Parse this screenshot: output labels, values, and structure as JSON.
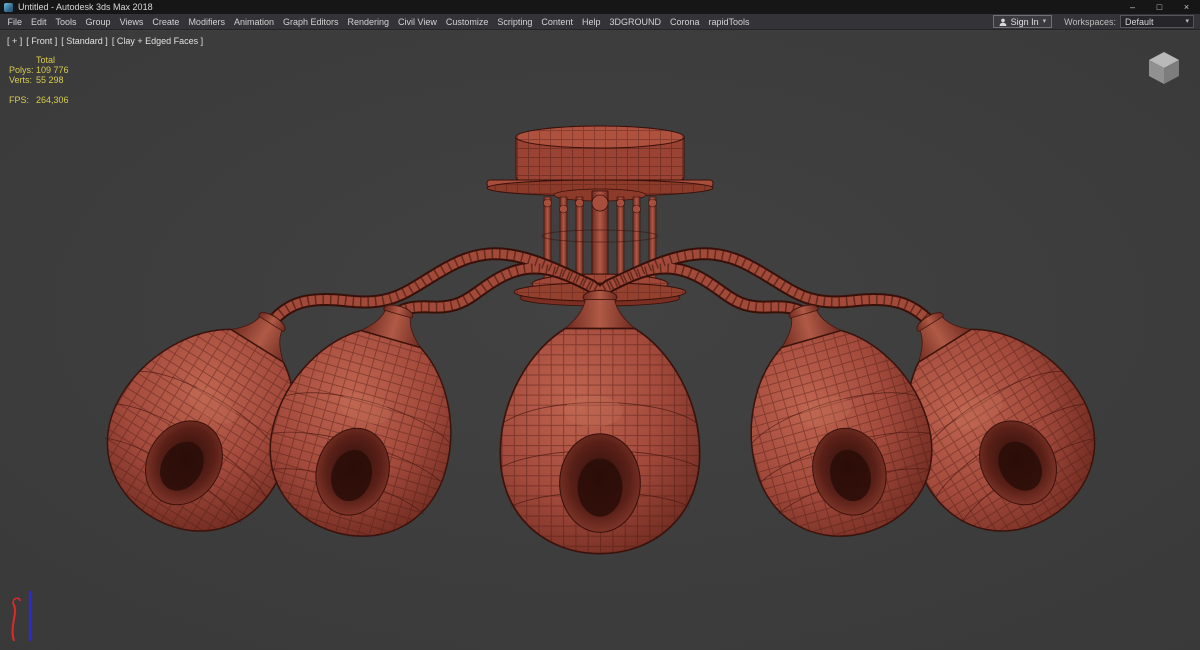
{
  "colors": {
    "titlebar_bg": "#161616",
    "menubar_bg": "#333338",
    "viewport_bg": "#3e3e3e",
    "stats_text": "#d9cc4e",
    "model_base": "#a34a3c",
    "model_wireframe": "#45170f"
  },
  "titlebar": {
    "title": "Untitled - Autodesk 3ds Max 2018",
    "controls": {
      "minimize": "–",
      "maximize": "□",
      "close": "×"
    }
  },
  "menubar": {
    "items": [
      "File",
      "Edit",
      "Tools",
      "Group",
      "Views",
      "Create",
      "Modifiers",
      "Animation",
      "Graph Editors",
      "Rendering",
      "Civil View",
      "Customize",
      "Scripting",
      "Content",
      "Help",
      "3DGROUND",
      "Corona",
      "rapidTools"
    ],
    "sign_in": "Sign In",
    "workspaces_label": "Workspaces:",
    "workspace_value": "Default",
    "caret": "▾"
  },
  "viewport": {
    "label_general": "[ + ]",
    "label_view": "[ Front ]",
    "label_shading_a": "[ Standard ]",
    "label_shading_b": "[ Clay + Edged Faces ]",
    "stats": {
      "total_label": "Total",
      "polys_label": "Polys:",
      "polys_value": "109 776",
      "verts_label": "Verts:",
      "verts_value": "55 298",
      "fps_label": "FPS:",
      "fps_value": "264,306"
    },
    "model_description": "5-arm chandelier, clay + edged faces wireframe"
  }
}
